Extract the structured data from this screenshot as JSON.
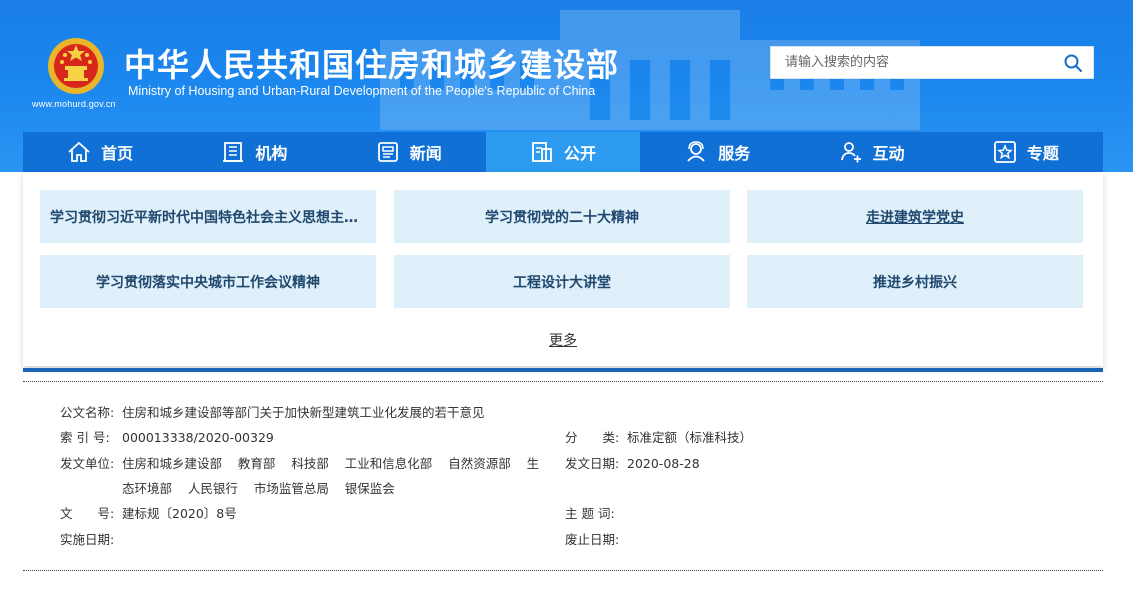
{
  "header": {
    "title": "中华人民共和国住房和城乡建设部",
    "subtitle": "Ministry of Housing and Urban-Rural Development of the People's Republic of China",
    "url": "www.mohurd.gov.cn",
    "search_placeholder": "请输入搜索的内容",
    "colors": {
      "header_bg": "#1b86ee",
      "nav_bg": "#1070d6",
      "nav_active": "#2d9cf0"
    }
  },
  "nav": {
    "items": [
      {
        "label": "首页",
        "icon": "home-icon"
      },
      {
        "label": "机构",
        "icon": "building-icon"
      },
      {
        "label": "新闻",
        "icon": "news-icon"
      },
      {
        "label": "公开",
        "icon": "document-icon",
        "active": true
      },
      {
        "label": "服务",
        "icon": "service-icon"
      },
      {
        "label": "互动",
        "icon": "interaction-icon"
      },
      {
        "label": "专题",
        "icon": "star-icon"
      }
    ]
  },
  "panel": {
    "tiles": [
      "学习贯彻习近平新时代中国特色社会主义思想主题教育",
      "学习贯彻党的二十大精神",
      "走进建筑学党史",
      "学习贯彻落实中央城市工作会议精神",
      "工程设计大讲堂",
      "推进乡村振兴"
    ],
    "more": "更多"
  },
  "info": {
    "doc_name_label": "公文名称:",
    "doc_name": "住房和城乡建设部等部门关于加快新型建筑工业化发展的若干意见",
    "index_label": "索 引 号:",
    "index": "000013338/2020-00329",
    "category_label": "分　　类:",
    "category": "标准定额（标准科技）",
    "issuer_label": "发文单位:",
    "issuers_line1": [
      "住房和城乡建设部",
      "教育部",
      "科技部",
      "工业和信息化部",
      "自然资源部",
      "生"
    ],
    "issuers_line2": [
      "态环境部",
      "人民银行",
      "市场监管总局",
      "银保监会"
    ],
    "date_label": "发文日期:",
    "date": "2020-08-28",
    "docno_label": "文　　号:",
    "docno": "建标规〔2020〕8号",
    "keywords_label": "主 题 词:",
    "keywords": "",
    "effective_label": "实施日期:",
    "effective": "",
    "expiry_label": "废止日期:",
    "expiry": ""
  }
}
